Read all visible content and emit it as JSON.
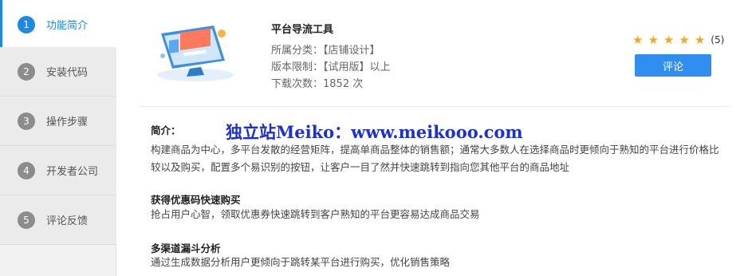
{
  "sidebar": {
    "items": [
      {
        "num": "1",
        "label": "功能简介",
        "active": true
      },
      {
        "num": "2",
        "label": "安装代码"
      },
      {
        "num": "3",
        "label": "操作步骤"
      },
      {
        "num": "4",
        "label": "开发者公司"
      },
      {
        "num": "5",
        "label": "评论反馈"
      }
    ]
  },
  "product": {
    "title": "平台导流工具",
    "category": "所属分类：【店铺设计】",
    "version": "版本限制：【试用版】以上",
    "downloads": "下载次数：1852 次",
    "rating": {
      "stars": 5,
      "count": "(5)"
    },
    "comment_button": "评论"
  },
  "watermark": "独立站Meiko：www.meikooo.com",
  "content": {
    "intro_title": "简介：",
    "intro_text": "构建商品为中心，多平台发散的经营矩阵，提高单商品整体的销售额；通常大多数人在选择商品时更倾向于熟知的平台进行价格比较以及购买，配置多个易识别的按钮，让客户一目了然并快速跳转到指向您其他平台的商品地址",
    "sec1_title": "获得优惠码快速购买",
    "sec1_text": "抢占用户心智，领取优惠券快速跳转到客户熟知的平台更容易达成商品交易",
    "sec2_title": "多渠道漏斗分析",
    "sec2_text": "通过生成数据分析用户更倾向于跳转某平台进行购买，优化销售策略"
  },
  "colors": {
    "accent": "#1e88e5",
    "button": "#2f8ef0",
    "star": "#f5a623",
    "watermark": "#1a2fd6"
  }
}
